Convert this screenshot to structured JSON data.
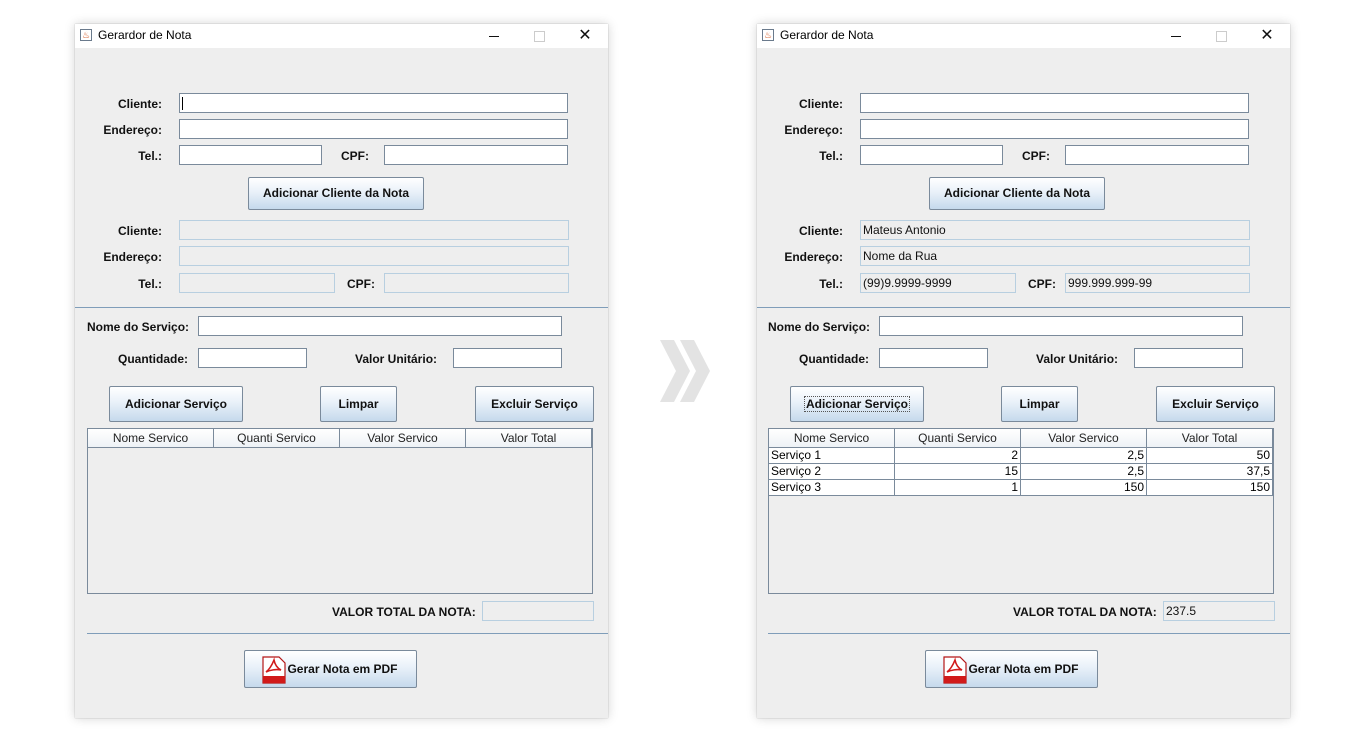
{
  "window_title": "Gerardor de Nota",
  "labels": {
    "cliente": "Cliente:",
    "endereco": "Endereço:",
    "tel": "Tel.:",
    "cpf": "CPF:",
    "nome_servico": "Nome do Serviço:",
    "quantidade": "Quantidade:",
    "valor_unitario": "Valor Unitário:",
    "valor_total_nota": "VALOR TOTAL DA NOTA:"
  },
  "buttons": {
    "adicionar_cliente": "Adicionar Cliente da Nota",
    "adicionar_servico": "Adicionar Serviço",
    "limpar": "Limpar",
    "excluir_servico": "Excluir Serviço",
    "gerar_pdf": "Gerar Nota em PDF"
  },
  "table_columns": [
    "Nome Servico",
    "Quanti Servico",
    "Valor Servico",
    "Valor Total"
  ],
  "before": {
    "cliente": "",
    "endereco": "",
    "tel": "",
    "cpf": "",
    "total": ""
  },
  "after": {
    "cliente": "Mateus Antonio",
    "endereco": "Nome da Rua",
    "tel": "(99)9.9999-9999",
    "cpf": "999.999.999-99",
    "total": "237.5",
    "rows": [
      [
        "Serviço 1",
        "2",
        "2,5",
        "50"
      ],
      [
        "Serviço 2",
        "15",
        "2,5",
        "37,5"
      ],
      [
        "Serviço 3",
        "1",
        "150",
        "150"
      ]
    ]
  },
  "colors": {
    "window_bg": "#eeeeee",
    "border": "#7a8a9b",
    "separator": "#7f9db9",
    "pdf_red": "#d11a1a"
  }
}
